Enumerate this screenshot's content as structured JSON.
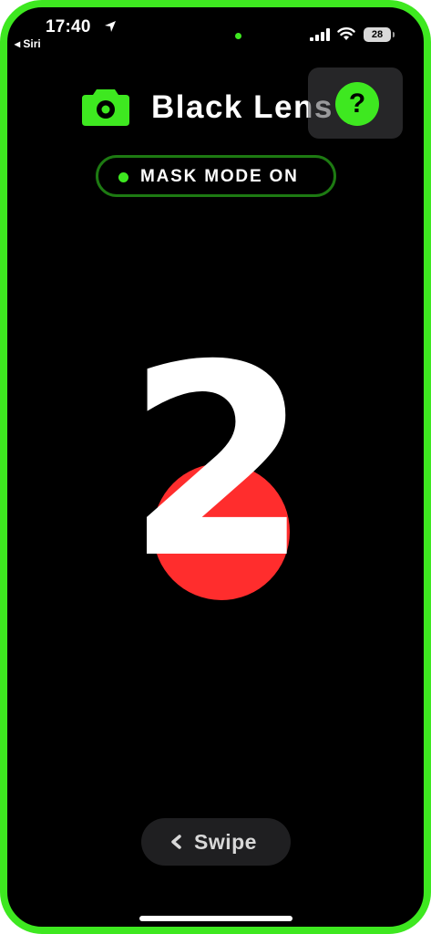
{
  "status_bar": {
    "time": "17:40",
    "back_label": "◂ Siri",
    "battery": "28",
    "icons": [
      "location-arrow-icon",
      "signal-icon",
      "wifi-icon",
      "battery-icon"
    ]
  },
  "header": {
    "title": "Black Lens",
    "help_label": "?",
    "icons": [
      "camera-icon"
    ]
  },
  "mask_mode": {
    "label": "MASK MODE ON"
  },
  "countdown": {
    "value": "2"
  },
  "swipe": {
    "label": "Swipe",
    "icon": "chevron-left-icon"
  },
  "colors": {
    "accent": "#3ee820",
    "record": "#ff2d2d",
    "background": "#000000",
    "pill_border": "#1d7a12"
  }
}
